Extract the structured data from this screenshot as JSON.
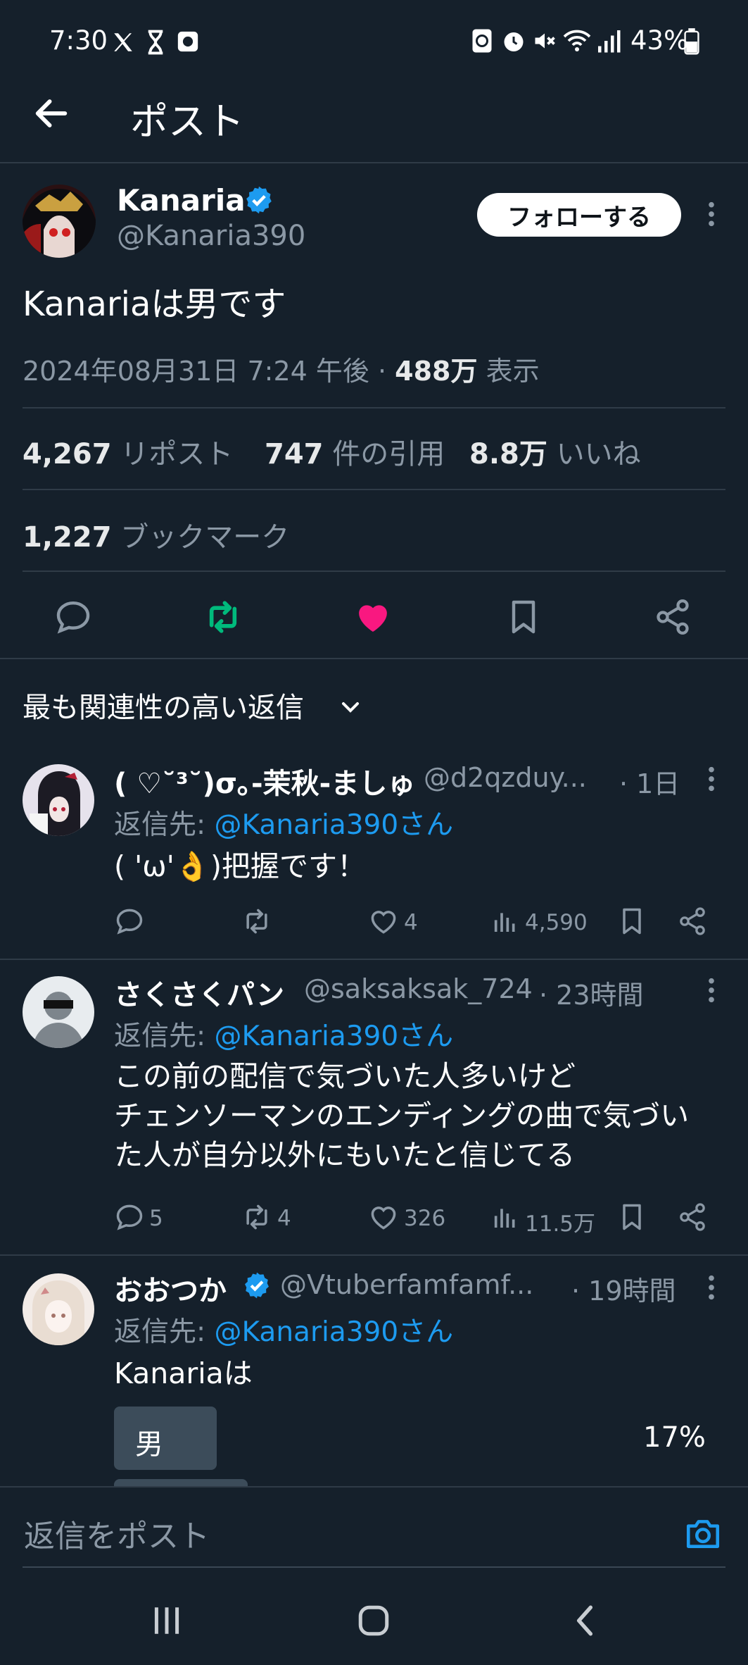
{
  "status_bar": {
    "time": "7:30",
    "battery": "43%",
    "left_icons": [
      "x-logo-icon",
      "hourglass-icon",
      "app-icon"
    ],
    "right_icons": [
      "sync-icon",
      "alarm-icon",
      "mute-icon",
      "wifi-icon",
      "signal-icon",
      "battery-icon"
    ]
  },
  "header": {
    "title": "ポスト"
  },
  "post": {
    "author": "Kanaria",
    "handle": "@Kanaria390",
    "verified": true,
    "follow_label": "フォローする",
    "text": "Kanariaは男です",
    "date": "2024年08月31日 7:24 午後",
    "views": "488万",
    "views_label": "表示",
    "reposts": "4,267",
    "reposts_label": "リポスト",
    "quotes": "747",
    "quotes_label": "件の引用",
    "likes": "8.8万",
    "likes_label": "いいね",
    "bookmarks": "1,227",
    "bookmarks_label": "ブックマーク"
  },
  "sort": {
    "label": "最も関連性の高い返信"
  },
  "replies": [
    {
      "name": "( ♡˘³˘)σ｡-茉秋-ましゅ",
      "handle": "@d2qzduy...",
      "time": "· 1日",
      "reply_prefix": "返信先:",
      "reply_to": "@Kanaria390さん",
      "text": "( 'ω'👌)把握です！",
      "replies_count": "",
      "reposts_count": "",
      "likes_count": "4",
      "views_count": "4,590"
    },
    {
      "name": "さくさくパン",
      "handle": "@saksaksak_724",
      "time": "· 23時間",
      "reply_prefix": "返信先:",
      "reply_to": "@Kanaria390さん",
      "text_lines": [
        "この前の配信で気づいた人多いけど",
        "チェンソーマンのエンディングの曲で気づい",
        "た人が自分以外にもいたと信じてる"
      ],
      "replies_count": "5",
      "reposts_count": "4",
      "likes_count": "326",
      "views_count": "11.5万"
    },
    {
      "name": "おおつか",
      "handle": "@Vtuberfamfamf...",
      "time": "· 19時間",
      "verified": true,
      "reply_prefix": "返信先:",
      "reply_to": "@Kanaria390さん",
      "text": "Kanariaは",
      "poll": [
        {
          "label": "男",
          "percent": "17%"
        }
      ]
    }
  ],
  "compose": {
    "placeholder": "返信をポスト"
  },
  "colors": {
    "background": "#15202b",
    "link": "#1d9bf0",
    "repost_active": "#00ba7c",
    "like_active": "#f91880"
  }
}
